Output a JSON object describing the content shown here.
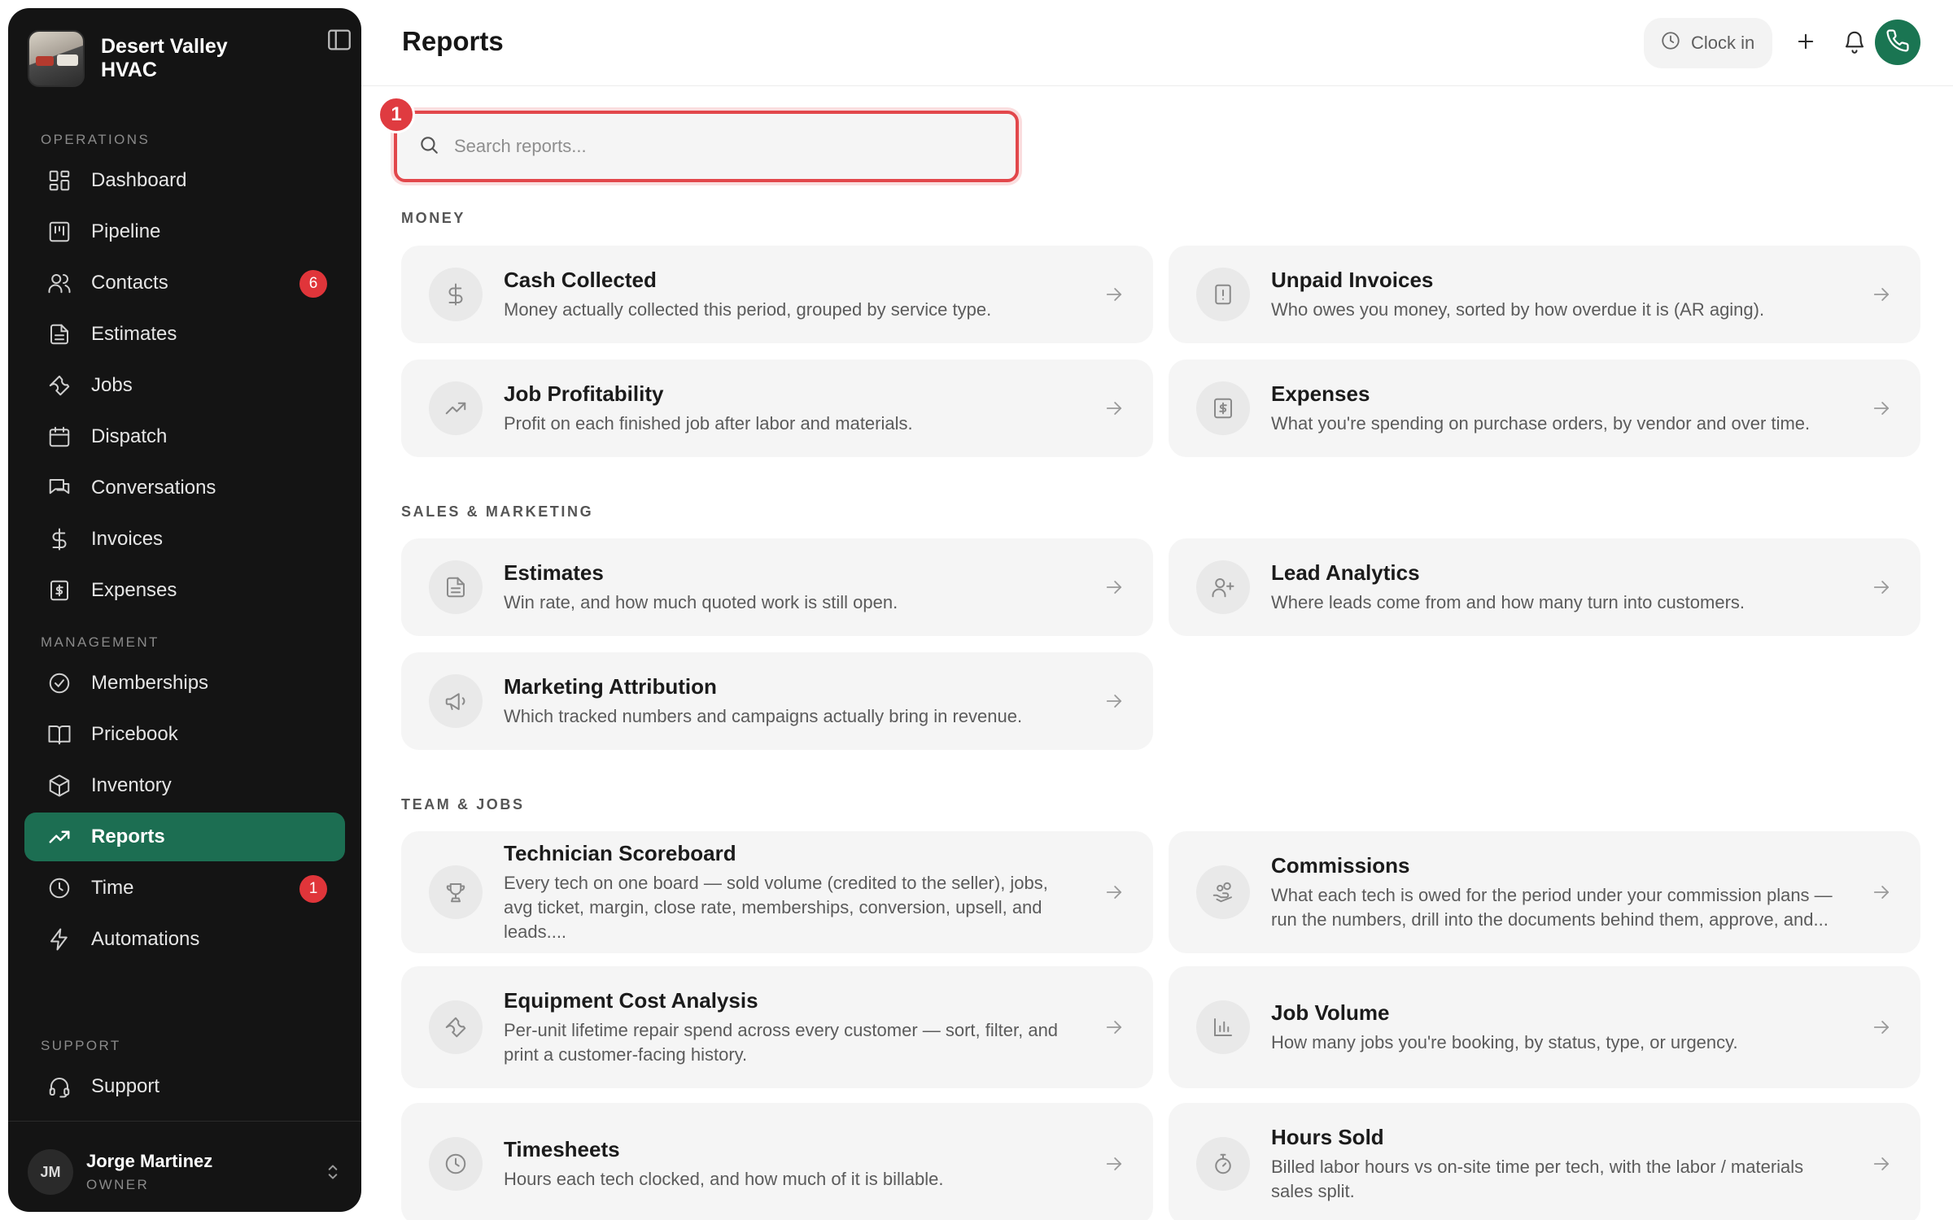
{
  "brand": {
    "name": "Desert Valley HVAC"
  },
  "sidebar": {
    "operations_label": "OPERATIONS",
    "management_label": "MANAGEMENT",
    "support_label": "SUPPORT",
    "items": [
      {
        "label": "Dashboard",
        "icon": "dashboard-icon"
      },
      {
        "label": "Pipeline",
        "icon": "pipeline-icon"
      },
      {
        "label": "Contacts",
        "icon": "contacts-icon",
        "badge": "6"
      },
      {
        "label": "Estimates",
        "icon": "document-icon"
      },
      {
        "label": "Jobs",
        "icon": "wrench-icon"
      },
      {
        "label": "Dispatch",
        "icon": "calendar-icon"
      },
      {
        "label": "Conversations",
        "icon": "chat-icon"
      },
      {
        "label": "Invoices",
        "icon": "dollar-icon"
      },
      {
        "label": "Expenses",
        "icon": "receipt-icon"
      },
      {
        "label": "Memberships",
        "icon": "check-circle-icon"
      },
      {
        "label": "Pricebook",
        "icon": "book-icon"
      },
      {
        "label": "Inventory",
        "icon": "box-icon"
      },
      {
        "label": "Reports",
        "icon": "trend-icon",
        "active": true
      },
      {
        "label": "Time",
        "icon": "clock-icon",
        "badge": "1"
      },
      {
        "label": "Automations",
        "icon": "bolt-icon"
      },
      {
        "label": "Support",
        "icon": "headset-icon"
      }
    ],
    "user": {
      "initials": "JM",
      "name": "Jorge Martinez",
      "role": "OWNER"
    }
  },
  "header": {
    "title": "Reports",
    "clock_in_label": "Clock in"
  },
  "search": {
    "placeholder": "Search reports...",
    "step": "1"
  },
  "sections": [
    {
      "label": "MONEY",
      "cards": [
        {
          "title": "Cash Collected",
          "desc": "Money actually collected this period, grouped by service type.",
          "icon": "dollar-icon"
        },
        {
          "title": "Unpaid Invoices",
          "desc": "Who owes you money, sorted by how overdue it is (AR aging).",
          "icon": "alert-document-icon"
        },
        {
          "title": "Job Profitability",
          "desc": "Profit on each finished job after labor and materials.",
          "icon": "trend-icon"
        },
        {
          "title": "Expenses",
          "desc": "What you're spending on purchase orders, by vendor and over time.",
          "icon": "receipt-icon"
        }
      ]
    },
    {
      "label": "SALES & MARKETING",
      "cards": [
        {
          "title": "Estimates",
          "desc": "Win rate, and how much quoted work is still open.",
          "icon": "document-icon"
        },
        {
          "title": "Lead Analytics",
          "desc": "Where leads come from and how many turn into customers.",
          "icon": "user-plus-icon"
        },
        {
          "title": "Marketing Attribution",
          "desc": "Which tracked numbers and campaigns actually bring in revenue.",
          "icon": "megaphone-icon"
        }
      ]
    },
    {
      "label": "TEAM & JOBS",
      "cards": [
        {
          "title": "Technician Scoreboard",
          "desc": "Every tech on one board — sold volume (credited to the seller), jobs, avg ticket, margin, close rate, memberships, conversion, upsell, and leads....",
          "icon": "trophy-icon"
        },
        {
          "title": "Commissions",
          "desc": "What each tech is owed for the period under your commission plans — run the numbers, drill into the documents behind them, approve, and...",
          "icon": "hand-coins-icon"
        },
        {
          "title": "Equipment Cost Analysis",
          "desc": "Per-unit lifetime repair spend across every customer — sort, filter, and print a customer-facing history.",
          "icon": "wrench-icon"
        },
        {
          "title": "Job Volume",
          "desc": "How many jobs you're booking, by status, type, or urgency.",
          "icon": "bar-chart-icon"
        },
        {
          "title": "Timesheets",
          "desc": "Hours each tech clocked, and how much of it is billable.",
          "icon": "clock-icon"
        },
        {
          "title": "Hours Sold",
          "desc": "Billed labor hours vs on-site time per tech, with the labor / materials sales split.",
          "icon": "stopwatch-icon"
        }
      ]
    }
  ],
  "colors": {
    "sidebar_bg": "#141414",
    "active_nav": "#1c6e52",
    "badge_red": "#e0353a",
    "phone_green": "#1a7552",
    "search_border": "#e2474b"
  }
}
